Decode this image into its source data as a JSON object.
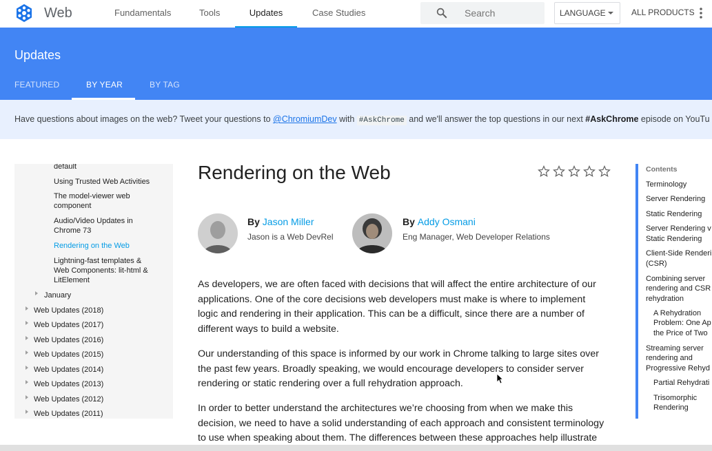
{
  "header": {
    "brand": "Web",
    "nav": [
      "Fundamentals",
      "Tools",
      "Updates",
      "Case Studies"
    ],
    "search_placeholder": "Search",
    "language": "LANGUAGE",
    "all_products": "ALL PRODUCTS"
  },
  "hero": {
    "title": "Updates",
    "tabs": [
      "FEATURED",
      "BY YEAR",
      "BY TAG"
    ]
  },
  "banner": {
    "prefix": "Have questions about images on the web? Tweet your questions to ",
    "link": "@ChromiumDev",
    "mid": " with ",
    "code": "#AskChrome",
    "mid2": " and we'll answer the top questions in our next ",
    "bold": "#AskChrome",
    "suffix": " episode on YouTu"
  },
  "leftnav": {
    "items": [
      "default",
      "Using Trusted Web Activities",
      "The model-viewer web",
      "component",
      "Audio/Video Updates in",
      "Chrome 73",
      "Rendering on the Web",
      "Lightning-fast templates &",
      "Web Components: lit-html &",
      "LitElement",
      "January",
      "Web Updates (2018)",
      "Web Updates (2017)",
      "Web Updates (2016)",
      "Web Updates (2015)",
      "Web Updates (2014)",
      "Web Updates (2013)",
      "Web Updates (2012)",
      "Web Updates (2011)"
    ]
  },
  "article": {
    "title": "Rendering on the Web",
    "rating_stars": 0,
    "authors": [
      {
        "by": "By",
        "name": "Jason Miller",
        "role": "Jason is a Web DevRel"
      },
      {
        "by": "By",
        "name": "Addy Osmani",
        "role": "Eng Manager, Web Developer Relations"
      }
    ],
    "paragraph_lines": [
      [
        "As developers, we are often faced with decisions that will affect the entire architecture of our",
        "applications. One of the core decisions web developers must make is where to implement",
        "logic and rendering in their application. This can be a difficult, since there are a number of",
        "different ways to build a website."
      ],
      [
        "Our understanding of this space is informed by our work in Chrome talking to large sites over",
        "the past few years. Broadly speaking, we would encourage developers to consider server",
        "rendering or static rendering over a full rehydration approach."
      ],
      [
        "In order to better understand the architectures we’re choosing from when we make this",
        "decision, we need to have a solid understanding of each approach and consistent terminology",
        "to use when speaking about them. The differences between these approaches help illustrate"
      ]
    ]
  },
  "toc": {
    "heading": "Contents",
    "items": [
      "Terminology",
      "Server Rendering",
      "Static Rendering",
      "Server Rendering v",
      "Static Rendering",
      "Client-Side Renderi",
      "(CSR)",
      "Combining server",
      "rendering and CSR",
      "rehydration",
      "A Rehydration",
      "Problem: One Ap",
      "the Price of Two",
      "Streaming server",
      "rendering and",
      "Progressive Rehyd",
      "Partial Rehydrati",
      "Trisomorphic",
      "Rendering"
    ]
  },
  "colors": {
    "primary": "#4285f4",
    "link": "#039be5",
    "banner_bg": "#e8f0fe"
  }
}
